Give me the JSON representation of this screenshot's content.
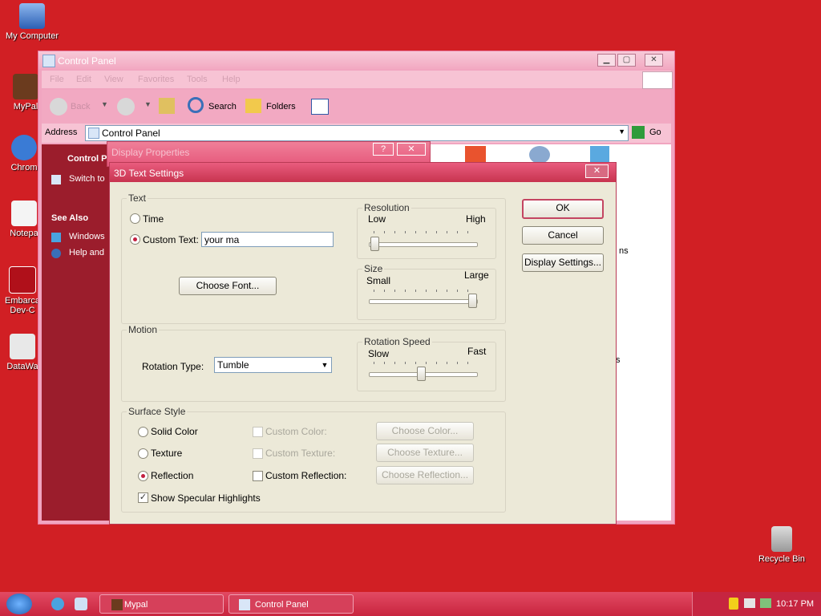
{
  "desktop": {
    "icons": [
      {
        "label": "My Computer"
      },
      {
        "label": "MyPal"
      },
      {
        "label": "Chrom"
      },
      {
        "label": "Notepa"
      },
      {
        "label": "Embarca\nDev-C"
      },
      {
        "label": "DataWa"
      },
      {
        "label": "Recycle Bin"
      }
    ]
  },
  "control_panel": {
    "title": "Control Panel",
    "menu": [
      "File",
      "Edit",
      "View",
      "Favorites",
      "Tools",
      "Help"
    ],
    "toolbar": {
      "back": "Back",
      "search": "Search",
      "folders": "Folders"
    },
    "address_label": "Address",
    "address_value": "Control Panel",
    "go": "Go",
    "taskpane": {
      "heading": "Control P",
      "switch": "Switch to",
      "see_also": "See Also",
      "items": [
        "Windows",
        "Help and"
      ]
    },
    "peek_text": [
      "ns",
      "s"
    ]
  },
  "display_properties": {
    "title": "Display Properties",
    "help": "?",
    "close": "✕"
  },
  "dialog": {
    "title": "3D Text Settings",
    "close": "✕",
    "text_group": {
      "label": "Text",
      "time": "Time",
      "custom_text": "Custom Text:",
      "custom_text_value": "your ma",
      "choose_font": "Choose Font..."
    },
    "resolution": {
      "label": "Resolution",
      "low": "Low",
      "high": "High",
      "value": 0
    },
    "size": {
      "label": "Size",
      "small": "Small",
      "large": "Large",
      "value": 1
    },
    "motion": {
      "label": "Motion",
      "rotation_type_label": "Rotation Type:",
      "rotation_type_value": "Tumble"
    },
    "rotation_speed": {
      "label": "Rotation Speed",
      "slow": "Slow",
      "fast": "Fast",
      "value": 0.5
    },
    "surface": {
      "label": "Surface Style",
      "solid_color": "Solid Color",
      "texture": "Texture",
      "reflection": "Reflection",
      "show_specular": "Show Specular Highlights",
      "custom_color": "Custom Color:",
      "custom_texture": "Custom Texture:",
      "custom_reflection": "Custom Reflection:",
      "choose_color": "Choose Color...",
      "choose_texture": "Choose Texture...",
      "choose_reflection": "Choose Reflection..."
    },
    "buttons": {
      "ok": "OK",
      "cancel": "Cancel",
      "display_settings": "Display Settings..."
    }
  },
  "taskbar": {
    "items": [
      "Mypal",
      "Control Panel"
    ],
    "clock": "10:17 PM"
  }
}
